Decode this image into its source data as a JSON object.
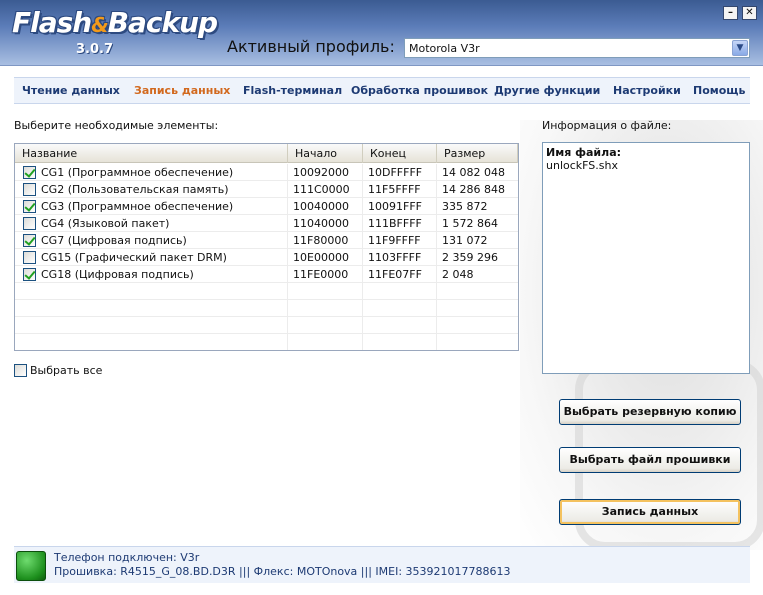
{
  "app": {
    "logo_main": "Flash",
    "logo_amp": "&",
    "logo_second": "Backup",
    "version": "3.0.7",
    "minimize_glyph": "–",
    "close_glyph": "✕"
  },
  "profile": {
    "label": "Активный профиль:",
    "value": "Motorola V3r",
    "arrow_glyph": "▼"
  },
  "menu": {
    "items": [
      {
        "label": "Чтение данных",
        "active": false
      },
      {
        "label": "Запись данных",
        "active": true
      },
      {
        "label": "Flash-терминал",
        "active": false
      },
      {
        "label": "Обработка прошивок",
        "active": false
      },
      {
        "label": "Другие функции",
        "active": false
      },
      {
        "label": "Настройки",
        "active": false
      },
      {
        "label": "Помощь",
        "active": false
      }
    ]
  },
  "elements": {
    "prompt": "Выберите необходимые элементы:",
    "columns": [
      "Название",
      "Начало",
      "Конец",
      "Размер"
    ],
    "rows": [
      {
        "checked": true,
        "name": "CG1 (Программное обеспечение)",
        "start": "10092000",
        "end": "10DFFFFF",
        "size": "14 082 048"
      },
      {
        "checked": false,
        "name": "CG2 (Пользовательская память)",
        "start": "111C0000",
        "end": "11F5FFFF",
        "size": "14 286 848"
      },
      {
        "checked": true,
        "name": "CG3 (Программное обеспечение)",
        "start": "10040000",
        "end": "10091FFF",
        "size": "335 872"
      },
      {
        "checked": false,
        "name": "CG4 (Языковой пакет)",
        "start": "11040000",
        "end": "111BFFFF",
        "size": "1 572 864"
      },
      {
        "checked": true,
        "name": "CG7 (Цифровая подпись)",
        "start": "11F80000",
        "end": "11F9FFFF",
        "size": "131 072"
      },
      {
        "checked": false,
        "name": "CG15 (Графический пакет DRM)",
        "start": "10E00000",
        "end": "1103FFFF",
        "size": "2 359 296"
      },
      {
        "checked": true,
        "name": "CG18 (Цифровая подпись)",
        "start": "11FE0000",
        "end": "11FE07FF",
        "size": "2 048"
      }
    ],
    "select_all_label": "Выбрать все",
    "select_all_checked": false
  },
  "file_info": {
    "title": "Информация о файле:",
    "name_label": "Имя файла:",
    "name_value": "unlockFS.shx"
  },
  "buttons": {
    "backup": "Выбрать резервную копию",
    "firmware": "Выбрать файл прошивки",
    "write": "Запись данных"
  },
  "status": {
    "line1": "Телефон подключен: V3r",
    "line2": "Прошивка: R4515_G_08.BD.D3R ||| Флекс: MOTOnova ||| IMEI: 353921017788613",
    "led_color": "#22a022"
  }
}
